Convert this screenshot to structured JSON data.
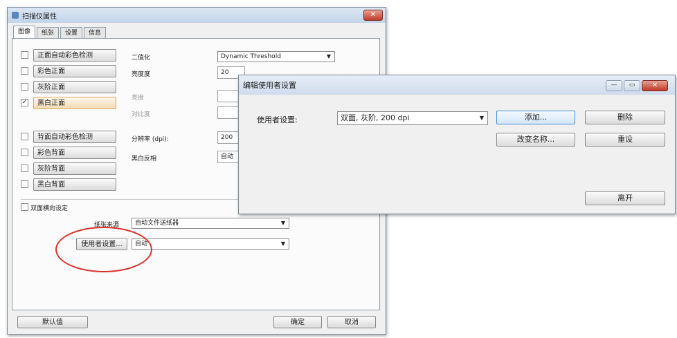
{
  "main_dialog": {
    "title": "扫描仪属性",
    "close_label": "✕",
    "tabs": [
      "图像",
      "纸张",
      "设置",
      "信息"
    ],
    "front_images": [
      {
        "label": "正面自动彩色检测",
        "checked": false
      },
      {
        "label": "彩色正面",
        "checked": false
      },
      {
        "label": "灰阶正面",
        "checked": false
      },
      {
        "label": "黑白正面",
        "checked": true
      }
    ],
    "back_images": [
      {
        "label": "背面自动彩色检测",
        "checked": false
      },
      {
        "label": "彩色背面",
        "checked": false
      },
      {
        "label": "灰阶背面",
        "checked": false
      },
      {
        "label": "黑白背面",
        "checked": false
      }
    ],
    "binarization_label": "二值化",
    "binarization_value": "Dynamic Threshold",
    "contrast_label": "亮度度",
    "contrast_value": "20",
    "brightness_label": "亮度",
    "contrast2_label": "对比度",
    "resolution_label": "分辨率 (dpi):",
    "resolution_value": "200",
    "bw_label": "黑白反相",
    "bw_value": "自动",
    "multifeed_label": "双面横向设定",
    "paper_source_label": "纸张来源",
    "paper_source_value": "自动文件送纸器",
    "user_settings_button": "使用者设置...",
    "user_settings_value": "自动",
    "default_button": "默认值",
    "ok_button": "确定",
    "cancel_button": "取消"
  },
  "user_dialog": {
    "title": "编辑使用者设置",
    "minimize": "—",
    "maximize": "▭",
    "close": "✕",
    "settings_label": "使用者设置:",
    "settings_value": "双面, 灰阶, 200 dpi",
    "add_button": "添加...",
    "delete_button": "删除",
    "rename_button": "改变名称...",
    "reset_button": "重设",
    "leave_button": "离开"
  }
}
